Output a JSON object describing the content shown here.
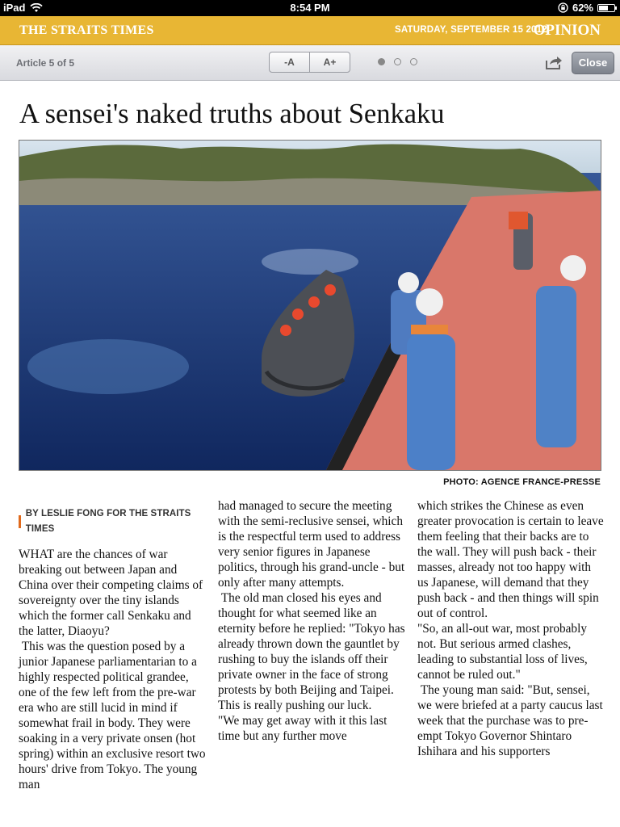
{
  "status": {
    "device": "iPad",
    "time": "8:54 PM",
    "battery": "62%",
    "battery_level": 0.62
  },
  "masthead": {
    "brand": "THE STRAITS TIMES",
    "date": "SATURDAY, SEPTEMBER 15 2012",
    "section": "OPINION"
  },
  "toolbar": {
    "article_count": "Article 5 of 5",
    "font_smaller": "-A",
    "font_larger": "A+",
    "close": "Close",
    "page_dots": 3,
    "active_dot": 0
  },
  "article": {
    "headline": "A sensei's naked truths about Senkaku",
    "photo_credit": "PHOTO: AGENCE FRANCE-PRESSE",
    "byline": "BY LESLIE FONG FOR THE STRAITS TIMES",
    "col1": [
      "WHAT are the chances of war breaking out between Japan and China over their competing claims of sovereignty over the tiny islands which the former call Senkaku and the latter, Diaoyu?",
      " This was the question posed by a junior Japanese parliamentarian to a highly respected political grandee, one of the few left from the pre-war era who are still lucid in mind if somewhat frail in body. They were soaking in a very private onsen (hot spring) within an exclusive resort two hours' drive from Tokyo. The young man"
    ],
    "col2": [
      "had managed to secure the meeting with the semi-reclusive sensei, which is the respectful term used to address very senior figures in Japanese politics, through his grand-uncle - but only after many attempts.",
      " The old man closed his eyes and thought for what seemed like an eternity before he replied: \"Tokyo has already thrown down the gauntlet by rushing to buy the islands off their private owner in the face of strong protests by both Beijing and Taipei. This is really pushing our luck.",
      "\"We may get away with it this last time but any further move"
    ],
    "col3": [
      "which strikes the Chinese as even greater provocation is certain to leave them feeling that their backs are to the wall. They will push back - their masses, already not too happy with us Japanese, will demand that they push back - and then things will spin out of control.",
      "\"So, an all-out war, most probably not. But serious armed clashes, leading to substantial loss of lives, cannot be ruled out.\"",
      " The young man said: \"But, sensei, we were briefed at a party caucus last week that the purchase was to pre-empt Tokyo Governor Shintaro Ishihara and his supporters"
    ]
  },
  "icons": {
    "wifi": "wifi-icon",
    "lock": "rotation-lock-icon",
    "battery": "battery-icon",
    "share": "share-icon"
  }
}
